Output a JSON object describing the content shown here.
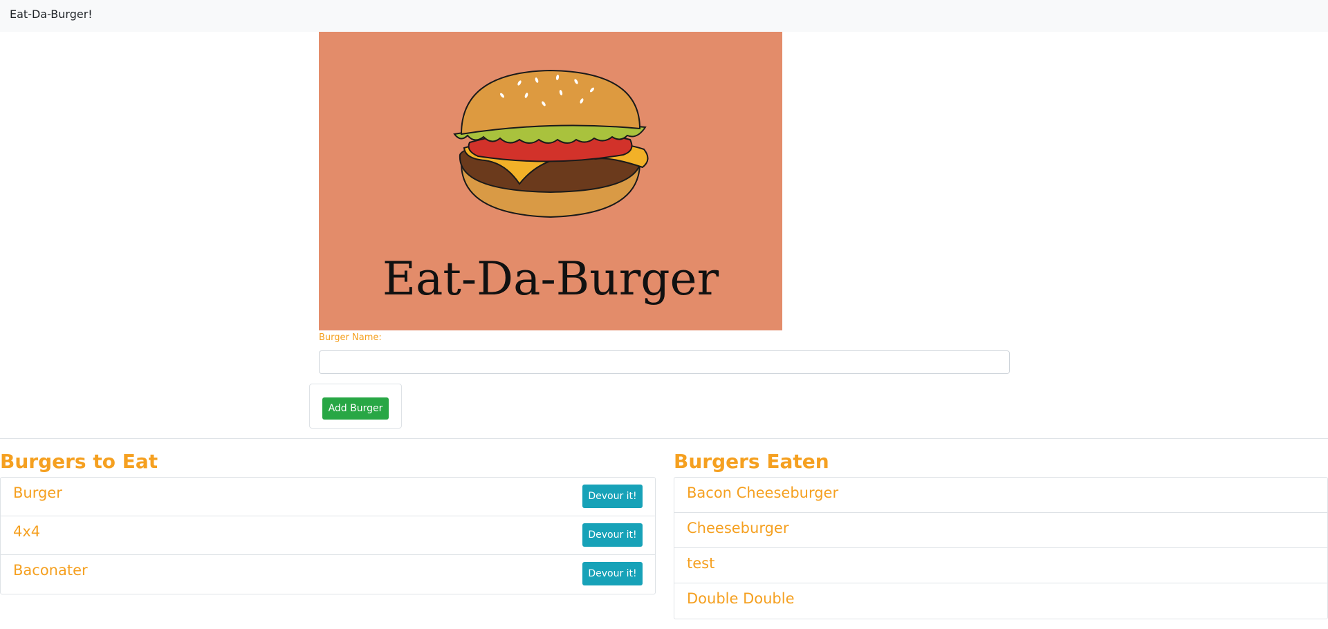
{
  "navbar": {
    "brand": "Eat-Da-Burger!"
  },
  "hero": {
    "logo_text": "Eat-Da-Burger",
    "background_color": "#e38c6a"
  },
  "form": {
    "label": "Burger Name:",
    "input_value": "",
    "input_placeholder": "",
    "submit_label": "Add Burger"
  },
  "to_eat": {
    "title": "Burgers to Eat",
    "items": [
      {
        "name": "Burger",
        "button": "Devour it!"
      },
      {
        "name": "4x4",
        "button": "Devour it!"
      },
      {
        "name": "Baconater",
        "button": "Devour it!"
      }
    ]
  },
  "eaten": {
    "title": "Burgers Eaten",
    "items": [
      {
        "name": "Bacon Cheeseburger"
      },
      {
        "name": "Cheeseburger"
      },
      {
        "name": "test"
      },
      {
        "name": "Double Double"
      }
    ]
  },
  "colors": {
    "accent": "#f5a020",
    "add_button": "#28a745",
    "devour_button": "#17a2b8"
  }
}
